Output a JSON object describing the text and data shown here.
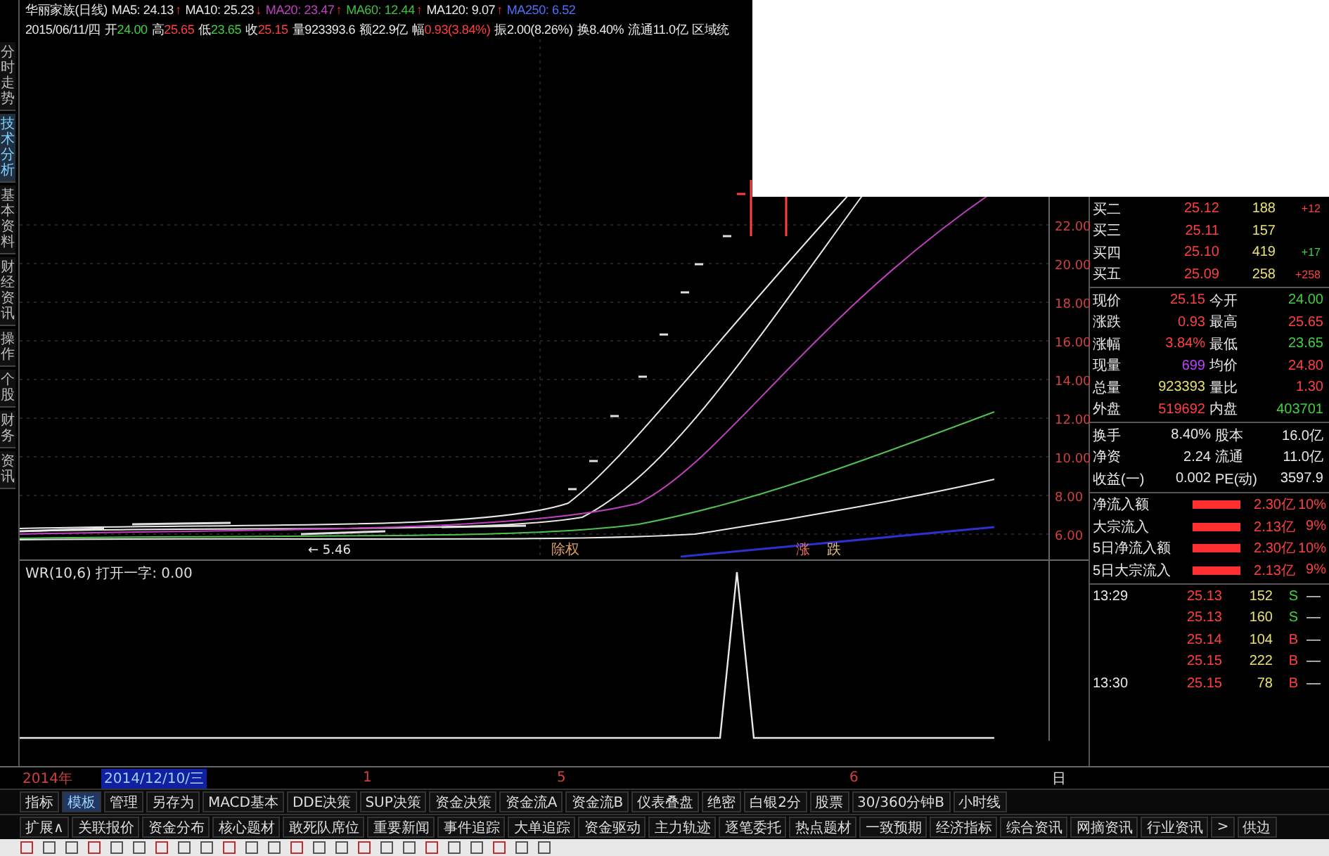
{
  "side_tabs": [
    {
      "label": "分时走势",
      "selected": false
    },
    {
      "label": "技术分析",
      "selected": true
    },
    {
      "label": "基本资料",
      "selected": false
    },
    {
      "label": "财经资讯",
      "selected": false
    },
    {
      "label": "操作",
      "selected": false
    },
    {
      "label": "个股",
      "selected": false
    },
    {
      "label": "财务",
      "selected": false
    },
    {
      "label": "资讯",
      "selected": false
    }
  ],
  "header": {
    "title": "华丽家族(日线)",
    "ma": [
      {
        "label": "MA5: 24.13",
        "arrow": "↑",
        "color": "#e8e8e8"
      },
      {
        "label": "MA10: 25.23",
        "arrow": "↓",
        "color": "#e8e8e8"
      },
      {
        "label": "MA20: 23.47",
        "arrow": "↑",
        "color": "#c040c0"
      },
      {
        "label": "MA60: 12.44",
        "arrow": "↑",
        "color": "#40c040"
      },
      {
        "label": "MA120: 9.07",
        "arrow": "↑",
        "color": "#e8e8e8"
      },
      {
        "label": "MA250: 6.52",
        "color": "#5070ff"
      }
    ],
    "date": "2015/06/11/四",
    "stats": [
      {
        "label": "开",
        "value": "24.00",
        "color": "#40d040"
      },
      {
        "label": "高",
        "value": "25.65",
        "color": "#ff4040"
      },
      {
        "label": "低",
        "value": "23.65",
        "color": "#40d040"
      },
      {
        "label": "收",
        "value": "25.15",
        "color": "#ff4040"
      },
      {
        "label": "量",
        "value": "923393.6",
        "color": "#e8e8e8"
      },
      {
        "label": "额",
        "value": "22.9亿",
        "color": "#e8e8e8"
      },
      {
        "label": "幅",
        "value": "0.93(3.84%)",
        "color": "#ff4040"
      },
      {
        "label": "振",
        "value": "2.00(8.26%)",
        "color": "#e8e8e8"
      },
      {
        "label": "换",
        "value": "8.40%",
        "color": "#e8e8e8"
      },
      {
        "label": "流通",
        "value": "11.0亿",
        "color": "#e8e8e8"
      },
      {
        "label": "区域统"
      }
    ]
  },
  "price_chart": {
    "yticks": [
      "22.00",
      "20.00",
      "18.00",
      "16.00",
      "14.00",
      "12.00",
      "10.00",
      "8.00",
      "6.00"
    ],
    "low_label": "← 5.46",
    "badges": [
      {
        "label": "除权",
        "color": "#e0a060"
      },
      {
        "label": "涨",
        "color": "#e07060"
      },
      {
        "label": "跌",
        "color": "#e0c080"
      }
    ]
  },
  "indicator": {
    "title": "WR(10,6)  打开一字: 0.00"
  },
  "x_axis": {
    "year": "2014年",
    "cursor_date": "2014/12/10/三",
    "labels": [
      "1",
      "5",
      "6"
    ],
    "period": "日"
  },
  "toolbar": [
    {
      "label": "指标",
      "selected": false
    },
    {
      "label": "模板",
      "selected": true
    },
    {
      "label": "管理",
      "selected": false
    },
    {
      "label": "另存为",
      "selected": false
    },
    {
      "label": "MACD基本",
      "selected": false
    },
    {
      "label": "DDE决策",
      "selected": false
    },
    {
      "label": "SUP决策",
      "selected": false
    },
    {
      "label": "资金决策",
      "selected": false
    },
    {
      "label": "资金流A",
      "selected": false
    },
    {
      "label": "资金流B",
      "selected": false
    },
    {
      "label": "仪表叠盘",
      "selected": false
    },
    {
      "label": "绝密",
      "selected": false
    },
    {
      "label": "白银2分",
      "selected": false
    },
    {
      "label": "股票",
      "selected": false
    },
    {
      "label": "30/360分钟B",
      "selected": false
    },
    {
      "label": "小时线",
      "selected": false
    }
  ],
  "info_tabs": [
    "扩展∧",
    "关联报价",
    "资金分布",
    "核心题材",
    "敢死队席位",
    "重要新闻",
    "事件追踪",
    "大单追踪",
    "资金驱动",
    "主力轨迹",
    "逐笔委托",
    "热点题材",
    "一致预期",
    "经济指标",
    "综合资讯",
    "网摘资讯",
    "行业资讯",
    ">",
    "供边"
  ],
  "order_book": [
    {
      "label": "买二",
      "price": "25.12",
      "volume": "188",
      "change": "+12",
      "color": "#ff4040"
    },
    {
      "label": "买三",
      "price": "25.11",
      "volume": "157"
    },
    {
      "label": "买四",
      "price": "25.10",
      "volume": "419",
      "change": "+17",
      "color": "#40d040"
    },
    {
      "label": "买五",
      "price": "25.09",
      "volume": "258",
      "change": "+258",
      "color": "#ff4040"
    }
  ],
  "quote_stats": [
    {
      "left": {
        "label": "现价",
        "value": "25.15",
        "color": "#ff4040"
      },
      "right": {
        "label": "今开",
        "value": "24.00",
        "color": "#40d040"
      }
    },
    {
      "left": {
        "label": "涨跌",
        "value": "0.93",
        "color": "#ff4040"
      },
      "right": {
        "label": "最高",
        "value": "25.65",
        "color": "#ff4040"
      }
    },
    {
      "left": {
        "label": "涨幅",
        "value": "3.84%",
        "color": "#ff4040"
      },
      "right": {
        "label": "最低",
        "value": "23.65",
        "color": "#40d040"
      }
    },
    {
      "left": {
        "label": "现量",
        "value": "699",
        "color": "#c040ff"
      },
      "right": {
        "label": "均价",
        "value": "24.80",
        "color": "#ff4040"
      }
    },
    {
      "left": {
        "label": "总量",
        "value": "923393",
        "color": "#e8e070"
      },
      "right": {
        "label": "量比",
        "value": "1.30",
        "color": "#ff4040"
      }
    },
    {
      "left": {
        "label": "外盘",
        "value": "519692",
        "color": "#ff4040"
      },
      "right": {
        "label": "内盘",
        "value": "403701",
        "color": "#40d040"
      }
    }
  ],
  "share_stats": [
    {
      "label": "换手",
      "value": "8.40%",
      "label2": "股本",
      "value2": "16.0亿"
    },
    {
      "label": "净资",
      "value": "2.24",
      "label2": "流通",
      "value2": "11.0亿"
    },
    {
      "label": "收益(一)",
      "value": "0.002",
      "label2": "PE(动)",
      "value2": "3597.9"
    }
  ],
  "fund_flow": [
    {
      "label": "净流入额",
      "value": "2.30亿",
      "percent": "10%"
    },
    {
      "label": "大宗流入",
      "value": "2.13亿",
      "percent": "9%"
    },
    {
      "label": "5日净流入额",
      "value": "2.30亿",
      "percent": "10%"
    },
    {
      "label": "5日大宗流入",
      "value": "2.13亿",
      "percent": "9%"
    }
  ],
  "ticks": [
    {
      "time": "13:29",
      "price": "25.13",
      "volume": "152",
      "side": "S",
      "mark": "—"
    },
    {
      "price": "25.13",
      "volume": "160",
      "side": "S",
      "mark": "—"
    },
    {
      "price": "25.14",
      "volume": "104",
      "side": "B",
      "mark": "—"
    },
    {
      "price": "25.15",
      "volume": "222",
      "side": "B",
      "mark": "—"
    },
    {
      "time": "13:30",
      "price": "25.15",
      "volume": "78",
      "side": "B",
      "mark": "—"
    }
  ]
}
